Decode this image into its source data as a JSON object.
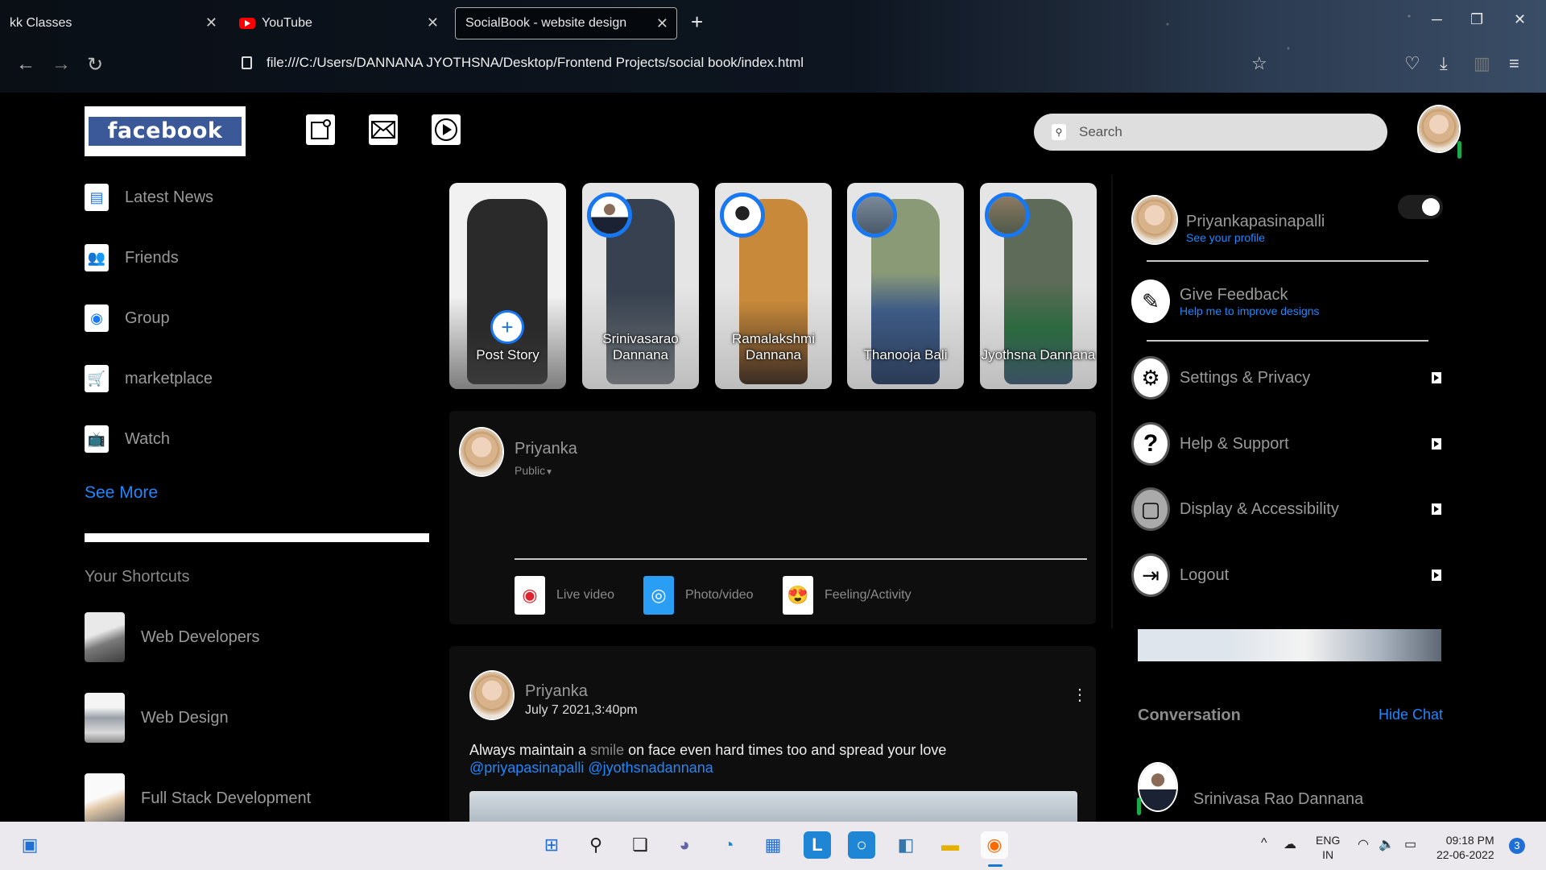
{
  "browser": {
    "tabs": [
      {
        "title": "kk Classes",
        "active": false
      },
      {
        "title": "YouTube",
        "active": false
      },
      {
        "title": "SocialBook - website design",
        "active": true
      }
    ],
    "url": "file:///C:/Users/DANNANA JYOTHSNA/Desktop/Frontend Projects/social book/index.html"
  },
  "header": {
    "logo": "facebook",
    "search_placeholder": "Search"
  },
  "left_nav": {
    "items": [
      {
        "label": "Latest News",
        "icon": "newspaper-icon"
      },
      {
        "label": "Friends",
        "icon": "friends-icon"
      },
      {
        "label": "Group",
        "icon": "group-icon"
      },
      {
        "label": "marketplace",
        "icon": "marketplace-icon"
      },
      {
        "label": "Watch",
        "icon": "tv-icon"
      }
    ],
    "see_more": "See More",
    "shortcuts_title": "Your Shortcuts",
    "shortcuts": [
      {
        "label": "Web Developers"
      },
      {
        "label": "Web Design"
      },
      {
        "label": "Full Stack Development"
      }
    ]
  },
  "stories": [
    {
      "name": "Post Story"
    },
    {
      "name": "Srinivasarao Dannana"
    },
    {
      "name": "Ramalakshmi Dannana"
    },
    {
      "name": "Thanooja Bali"
    },
    {
      "name": "Jyothsna Dannana"
    }
  ],
  "create_post": {
    "user": "Priyanka",
    "privacy": "Public",
    "actions": [
      {
        "label": "Live video",
        "icon": "live-video-icon"
      },
      {
        "label": "Photo/video",
        "icon": "camera-icon"
      },
      {
        "label": "Feeling/Activity",
        "icon": "emoji-icon"
      }
    ]
  },
  "post": {
    "user": "Priyanka",
    "date": "July 7 2021,3:40pm",
    "text_before": "Always maintain a",
    "highlight": "smile",
    "text_after": "on face even hard times too and spread your love",
    "tags": "@priyapasinapalli @jyothsnadannana"
  },
  "settings_menu": {
    "profile_name": "Priyankapasinapalli",
    "profile_link": "See your profile",
    "feedback_title": "Give Feedback",
    "feedback_sub": "Help me to improve designs",
    "items": [
      {
        "label": "Settings & Privacy",
        "icon": "gear-icon"
      },
      {
        "label": "Help & Support",
        "icon": "question-icon"
      },
      {
        "label": "Display & Accessibility",
        "icon": "display-icon"
      },
      {
        "label": "Logout",
        "icon": "logout-icon"
      }
    ]
  },
  "conversation": {
    "title": "Conversation",
    "hide_chat": "Hide Chat",
    "contacts": [
      {
        "name": "Srinivasa Rao Dannana",
        "online": true
      }
    ]
  },
  "taskbar": {
    "lang_top": "ENG",
    "lang_bottom": "IN",
    "time": "09:18 PM",
    "date": "22-06-2022",
    "notifications": "3"
  },
  "colors": {
    "accent": "#1877f2",
    "link": "#1f87ff",
    "online": "#1ba94c",
    "logo_bg": "#3b5998"
  }
}
